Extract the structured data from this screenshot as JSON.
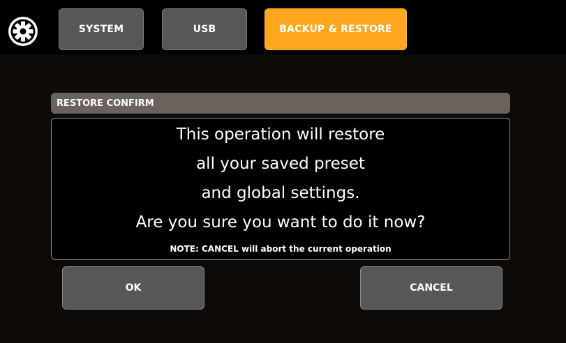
{
  "tabs": {
    "system": "SYSTEM",
    "usb": "USB",
    "backup_restore": "BACKUP & RESTORE"
  },
  "settings_icon": "gear-icon",
  "dialog": {
    "title": "RESTORE CONFIRM",
    "message_lines": [
      "This operation will restore",
      "all your saved preset",
      "and global settings.",
      "Are you sure you want to do it now?"
    ],
    "note": "NOTE: CANCEL will abort the current operation"
  },
  "buttons": {
    "ok": "OK",
    "cancel": "CANCEL"
  },
  "colors": {
    "active_tab": "#ffa71c",
    "inactive_tab": "#575757",
    "header_bar": "#6b625d",
    "background": "#000000"
  }
}
